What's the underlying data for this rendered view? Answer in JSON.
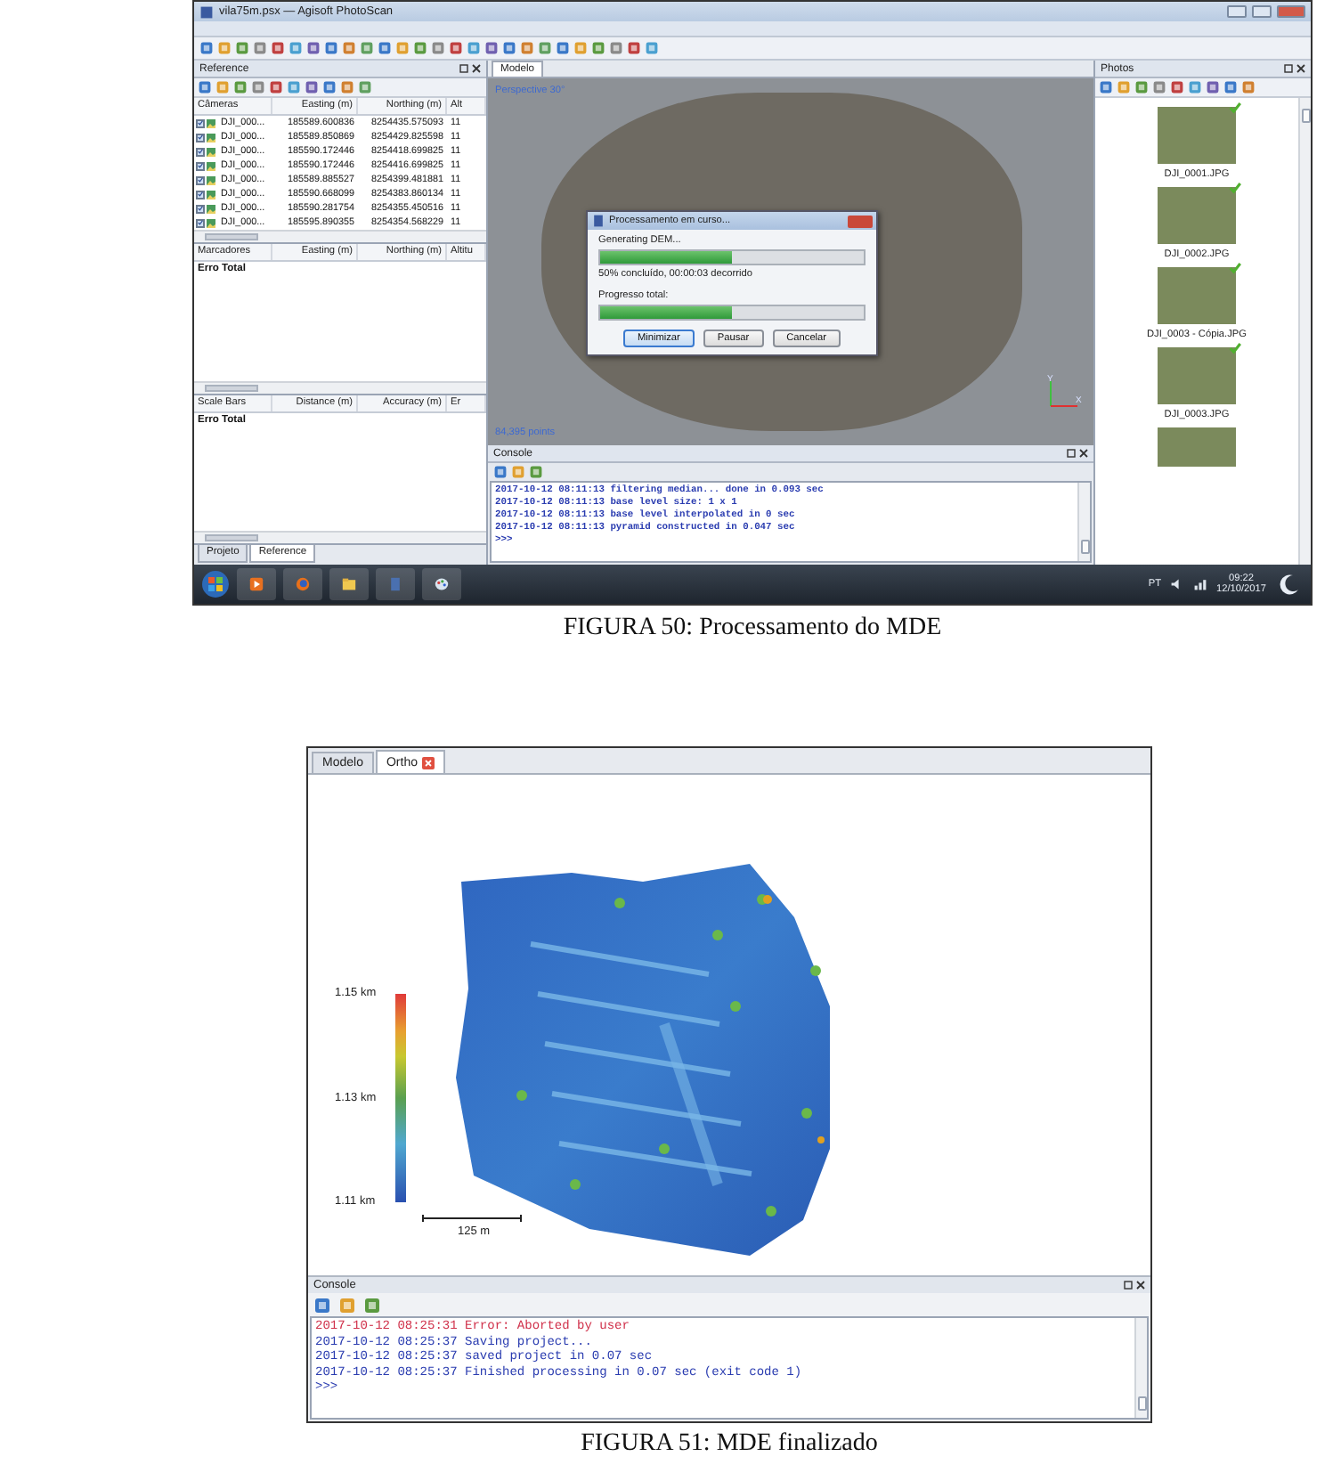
{
  "figure_50": {
    "window": {
      "title": "vila75m.psx — Agisoft PhotoScan"
    },
    "reference_panel": {
      "title": "Reference",
      "cameras": {
        "columns": [
          "Câmeras",
          "Easting (m)",
          "Northing (m)",
          "Alt"
        ],
        "rows": [
          {
            "name": "DJI_000...",
            "easting": "185589.600836",
            "northing": "8254435.575093",
            "alt": "11",
            "checked": true
          },
          {
            "name": "DJI_000...",
            "easting": "185589.850869",
            "northing": "8254429.825598",
            "alt": "11",
            "checked": true
          },
          {
            "name": "DJI_000...",
            "easting": "185590.172446",
            "northing": "8254418.699825",
            "alt": "11",
            "checked": true
          },
          {
            "name": "DJI_000...",
            "easting": "185590.172446",
            "northing": "8254416.699825",
            "alt": "11",
            "checked": true
          },
          {
            "name": "DJI_000...",
            "easting": "185589.885527",
            "northing": "8254399.481881",
            "alt": "11",
            "checked": true
          },
          {
            "name": "DJI_000...",
            "easting": "185590.668099",
            "northing": "8254383.860134",
            "alt": "11",
            "checked": true
          },
          {
            "name": "DJI_000...",
            "easting": "185590.281754",
            "northing": "8254355.450516",
            "alt": "11",
            "checked": true
          },
          {
            "name": "DJI_000...",
            "easting": "185595.890355",
            "northing": "8254354.568229",
            "alt": "11",
            "checked": true
          }
        ]
      },
      "markers": {
        "columns": [
          "Marcadores",
          "Easting (m)",
          "Northing (m)",
          "Altitu"
        ],
        "rows": [
          "Erro Total"
        ]
      },
      "scale_bars": {
        "columns": [
          "Scale Bars",
          "Distance (m)",
          "Accuracy (m)",
          "Er"
        ],
        "rows": [
          "Erro Total"
        ]
      },
      "tabs": [
        {
          "label": "Projeto",
          "selected": false
        },
        {
          "label": "Reference",
          "selected": true
        }
      ]
    },
    "model_tab": "Modelo",
    "viewport": {
      "projection": "Perspective 30°",
      "points": "84,395 points",
      "axis_y": "Y",
      "axis_x": "X"
    },
    "dialog": {
      "title": "Processamento em curso...",
      "task": "Generating DEM...",
      "task_progress": {
        "level": 0.5
      },
      "task_status": "50% concluído, 00:00:03 decorrido",
      "total_label": "Progresso total:",
      "total_progress": {
        "level": 0.5
      },
      "buttons": [
        {
          "label": "Minimizar",
          "selected": true
        },
        {
          "label": "Pausar",
          "selected": false
        },
        {
          "label": "Cancelar",
          "selected": false
        }
      ]
    },
    "console": {
      "title": "Console",
      "lines": [
        {
          "text": "2017-10-12 08:11:13 filtering median... done in 0.093 sec",
          "kind": "info"
        },
        {
          "text": "2017-10-12 08:11:13 base level size: 1 x 1",
          "kind": "info"
        },
        {
          "text": "2017-10-12 08:11:13 base level interpolated in 0 sec",
          "kind": "info"
        },
        {
          "text": "2017-10-12 08:11:13 pyramid constructed in 0.047 sec",
          "kind": "info"
        },
        {
          "text": ">>>",
          "kind": "info"
        }
      ]
    },
    "photos_panel": {
      "title": "Photos",
      "items": [
        {
          "caption": "DJI_0001.JPG"
        },
        {
          "caption": "DJI_0002.JPG"
        },
        {
          "caption": "DJI_0003 - Cópia.JPG"
        },
        {
          "caption": "DJI_0003.JPG"
        }
      ]
    },
    "taskbar": {
      "language": "PT",
      "time": "09:22",
      "date": "12/10/2017"
    }
  },
  "caption_50": "FIGURA 50: Processamento do MDE",
  "figure_51": {
    "tabs": [
      {
        "label": "Modelo",
        "selected": false,
        "closable": false
      },
      {
        "label": "Ortho",
        "selected": true,
        "closable": true
      }
    ],
    "legend": {
      "max": "1.15 km",
      "mid": "1.13 km",
      "min": "1.11 km"
    },
    "scale_bar": "125 m",
    "console": {
      "title": "Console",
      "lines": [
        {
          "text": "2017-10-12 08:25:31 Error: Aborted by user",
          "kind": "error"
        },
        {
          "text": "2017-10-12 08:25:37 Saving project...",
          "kind": "info"
        },
        {
          "text": "2017-10-12 08:25:37 saved project in 0.07 sec",
          "kind": "info"
        },
        {
          "text": "2017-10-12 08:25:37 Finished processing in 0.07 sec (exit code 1)",
          "kind": "info"
        },
        {
          "text": ">>>",
          "kind": "info"
        }
      ]
    }
  },
  "caption_51": "FIGURA 51: MDE finalizado"
}
